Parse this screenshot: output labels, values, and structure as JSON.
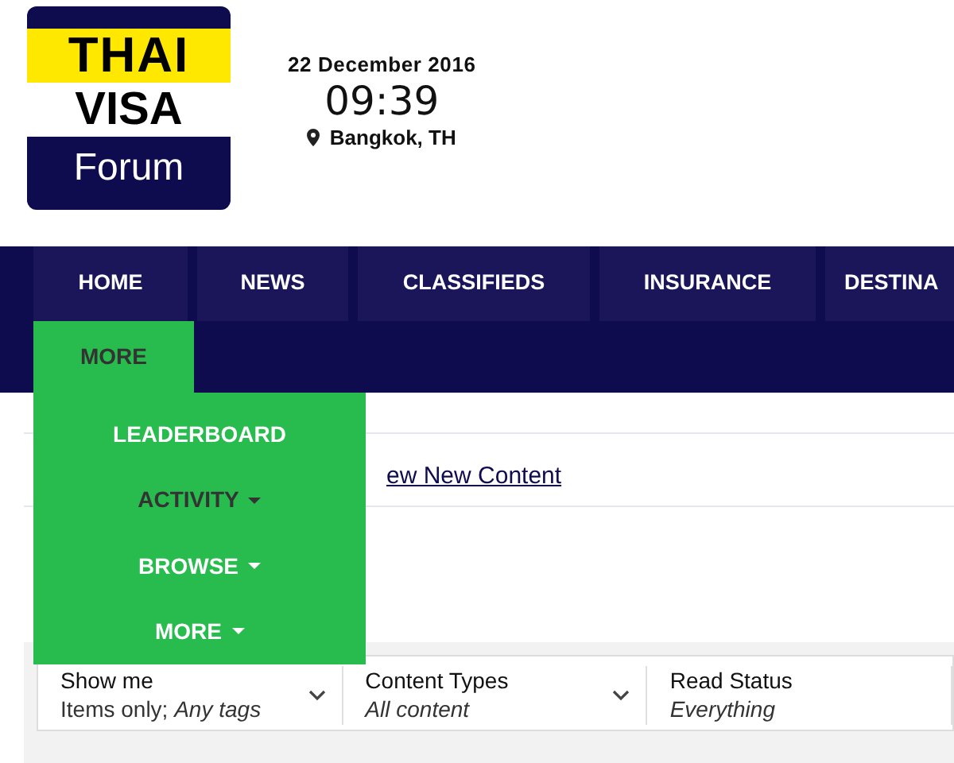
{
  "logo": {
    "line_1": "THAI",
    "line_2": "VISA",
    "line_3": "Forum"
  },
  "header": {
    "date": "22 December 2016",
    "time": "09:39",
    "location": "Bangkok, TH"
  },
  "nav": {
    "tabs": [
      {
        "label": "HOME",
        "selected": false
      },
      {
        "label": "NEWS",
        "selected": false
      },
      {
        "label": "CLASSIFIEDS",
        "selected": false
      },
      {
        "label": "INSURANCE",
        "selected": false
      },
      {
        "label": "DESTINA",
        "selected": false
      }
    ],
    "more_tab": {
      "label": "MORE",
      "expanded": true
    },
    "dropdown": [
      {
        "label": "LEADERBOARD",
        "has_submenu": false,
        "hovered": false
      },
      {
        "label": "ACTIVITY",
        "has_submenu": true,
        "hovered": true
      },
      {
        "label": "BROWSE",
        "has_submenu": true,
        "hovered": false
      },
      {
        "label": "MORE",
        "has_submenu": true,
        "hovered": false
      }
    ]
  },
  "breadcrumb": {
    "link": "ew New Content"
  },
  "filters": [
    {
      "label": "Show me",
      "value": "Items only; *Any tags*",
      "chevron": true
    },
    {
      "label": "Content Types",
      "value": "*All content*",
      "chevron": true
    },
    {
      "label": "Read Status",
      "value": "*Everything*",
      "chevron": false
    }
  ]
}
